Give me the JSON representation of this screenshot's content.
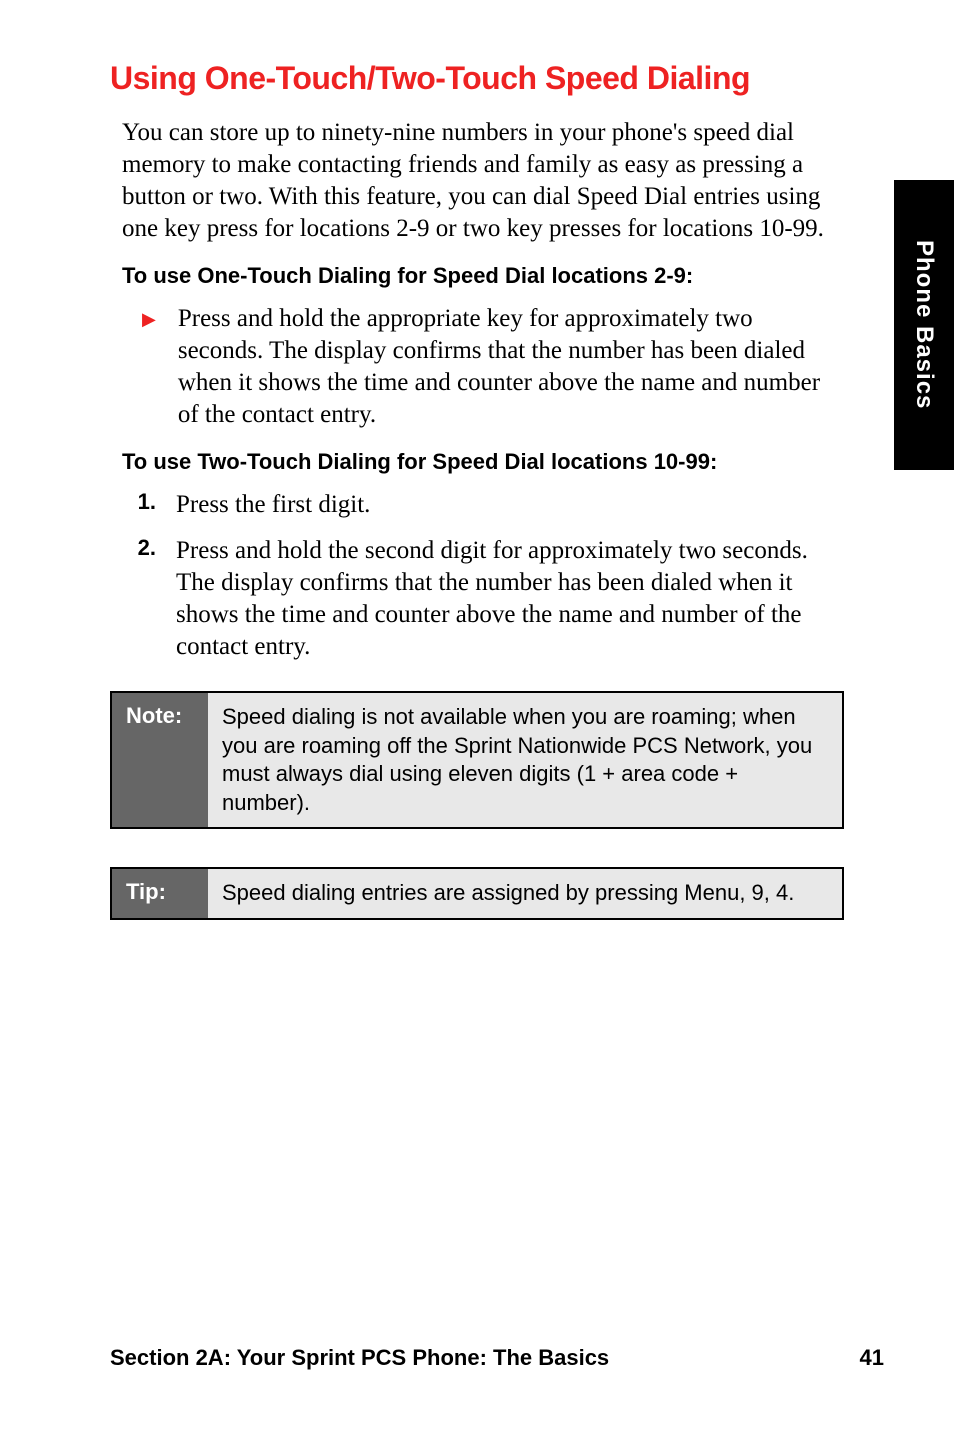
{
  "side_tab": "Phone Basics",
  "heading": "Using One-Touch/Two-Touch Speed Dialing",
  "intro": "You can store up to ninety-nine numbers in your phone's speed dial memory to make contacting friends and family as easy as pressing a button or two. With this feature, you can dial Speed Dial entries using one key press for locations 2-9 or two key presses for locations 10-99.",
  "sub1": "To use One-Touch Dialing for Speed Dial locations 2-9:",
  "bullet1": "Press and hold the appropriate key for approximately two seconds. The display confirms that the number has been dialed when it shows the time and counter above the name and number of the contact entry.",
  "sub2": "To use Two-Touch Dialing for Speed Dial locations 10-99:",
  "steps": {
    "n1": "1.",
    "t1": "Press the first digit.",
    "n2": "2.",
    "t2": "Press and hold the second digit for approximately two seconds. The display confirms that the number has been dialed when it shows the time and counter above the name and number of the contact entry."
  },
  "note_label": "Note:",
  "note_text": "Speed dialing is not available when you are roaming; when you are roaming off the Sprint Nationwide PCS Network, you must always dial using eleven digits (1 + area code + number).",
  "tip_label": "Tip:",
  "tip_text": "Speed dialing entries are assigned by pressing Menu, 9, 4.",
  "footer_left": "Section 2A: Your Sprint PCS Phone: The Basics",
  "footer_right": "41"
}
